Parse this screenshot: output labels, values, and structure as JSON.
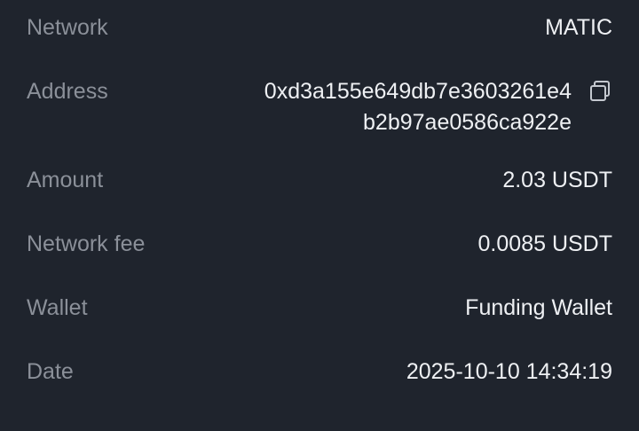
{
  "details": {
    "network": {
      "label": "Network",
      "value": "MATIC"
    },
    "address": {
      "label": "Address",
      "line1": "0xd3a155e649db7e3603261e4",
      "line2": "b2b97ae0586ca922e",
      "icon": "copy-icon"
    },
    "amount": {
      "label": "Amount",
      "value": "2.03 USDT"
    },
    "network_fee": {
      "label": "Network fee",
      "value": "0.0085 USDT"
    },
    "wallet": {
      "label": "Wallet",
      "value": "Funding Wallet"
    },
    "date": {
      "label": "Date",
      "value": "2025-10-10 14:34:19"
    }
  },
  "colors": {
    "background": "#1f242d",
    "label": "#8b9099",
    "value": "#eef0f3",
    "icon": "#c4c8cf"
  }
}
